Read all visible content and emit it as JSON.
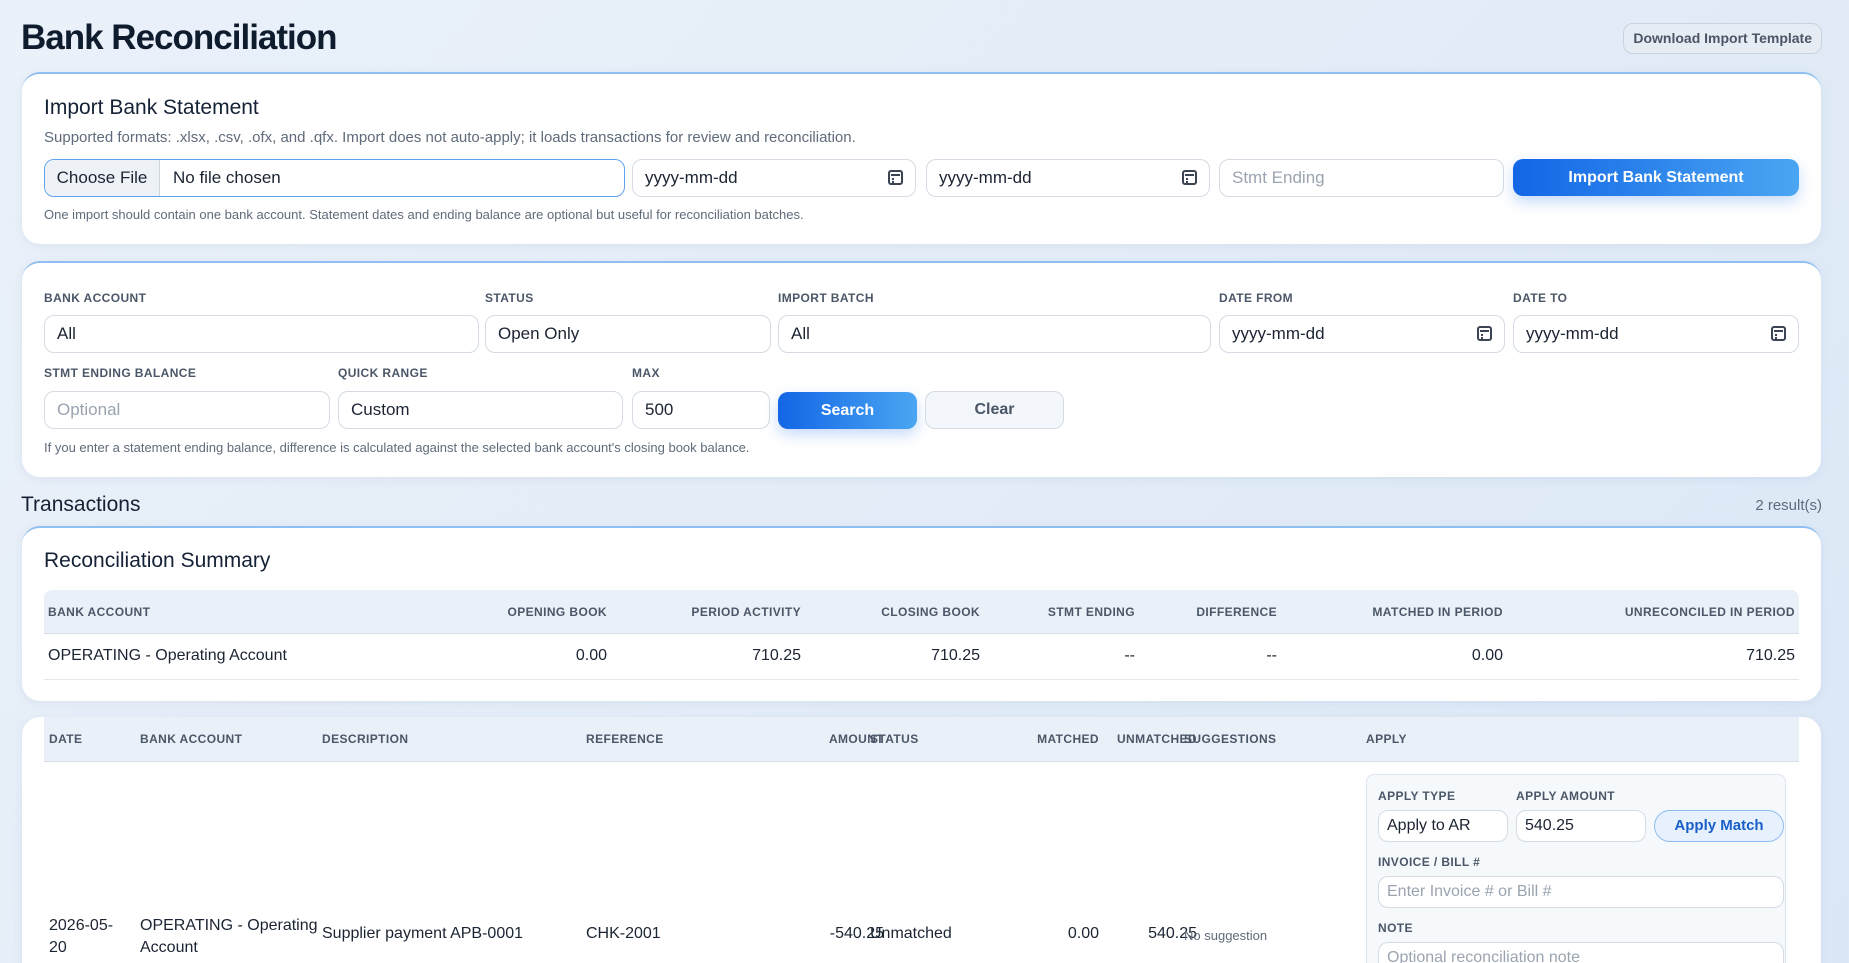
{
  "page": {
    "title": "Bank Reconciliation",
    "download_label": "Download Import Template"
  },
  "import": {
    "title": "Import Bank Statement",
    "subtitle": "Supported formats: .xlsx, .csv, .ofx, and .qfx. Import does not auto-apply; it loads transactions for review and reconciliation.",
    "choose_label": "Choose File",
    "file_name": "No file chosen",
    "start_date_placeholder": "yyyy-mm-dd",
    "end_date_placeholder": "yyyy-mm-dd",
    "stmt_ending_placeholder": "Stmt Ending",
    "import_label": "Import Bank Statement",
    "note": "One import should contain one bank account. Statement dates and ending balance are optional but useful for reconciliation batches."
  },
  "filters": {
    "bank_account_label": "BANK ACCOUNT",
    "bank_account_value": "All",
    "status_label": "STATUS",
    "status_value": "Open Only",
    "import_batch_label": "IMPORT BATCH",
    "import_batch_value": "All",
    "date_from_label": "DATE FROM",
    "date_from_value": "yyyy-mm-dd",
    "date_to_label": "DATE TO",
    "date_to_value": "yyyy-mm-dd",
    "stmt_ending_label": "STMT ENDING BALANCE",
    "stmt_ending_placeholder": "Optional",
    "quick_range_label": "QUICK RANGE",
    "quick_range_value": "Custom",
    "max_label": "MAX",
    "max_value": "500",
    "search_label": "Search",
    "clear_label": "Clear",
    "note": "If you enter a statement ending balance, difference is calculated against the selected bank account's closing book balance."
  },
  "transactions": {
    "title": "Transactions",
    "result_count": "2 result(s)"
  },
  "summary": {
    "title": "Reconciliation Summary",
    "headers": [
      "BANK ACCOUNT",
      "OPENING BOOK",
      "PERIOD ACTIVITY",
      "CLOSING BOOK",
      "STMT ENDING",
      "DIFFERENCE",
      "MATCHED IN PERIOD",
      "UNRECONCILED IN PERIOD"
    ],
    "row": [
      "OPERATING - Operating Account",
      "0.00",
      "710.25",
      "710.25",
      "--",
      "--",
      "0.00",
      "710.25"
    ]
  },
  "table": {
    "headers": [
      "DATE",
      "BANK ACCOUNT",
      "DESCRIPTION",
      "REFERENCE",
      "AMOUNT",
      "STATUS",
      "MATCHED",
      "UNMATCHED",
      "SUGGESTIONS",
      "APPLY"
    ],
    "row": {
      "date_line1": "2026-05-",
      "date_line2": "20",
      "account_line1": "OPERATING - Operating",
      "account_line2": "Account",
      "description": "Supplier payment APB-0001",
      "reference": "CHK-2001",
      "amount": "-540.25",
      "status": "Unmatched",
      "matched": "0.00",
      "unmatched": "540.25",
      "suggestion": "No suggestion"
    },
    "apply": {
      "type_label": "APPLY TYPE",
      "type_value": "Apply to AR",
      "amount_label": "APPLY AMOUNT",
      "amount_value": "540.25",
      "apply_match_label": "Apply Match",
      "invoice_label": "INVOICE / BILL #",
      "invoice_placeholder": "Enter Invoice # or Bill #",
      "note_label": "NOTE",
      "note_placeholder": "Optional reconciliation note"
    }
  }
}
